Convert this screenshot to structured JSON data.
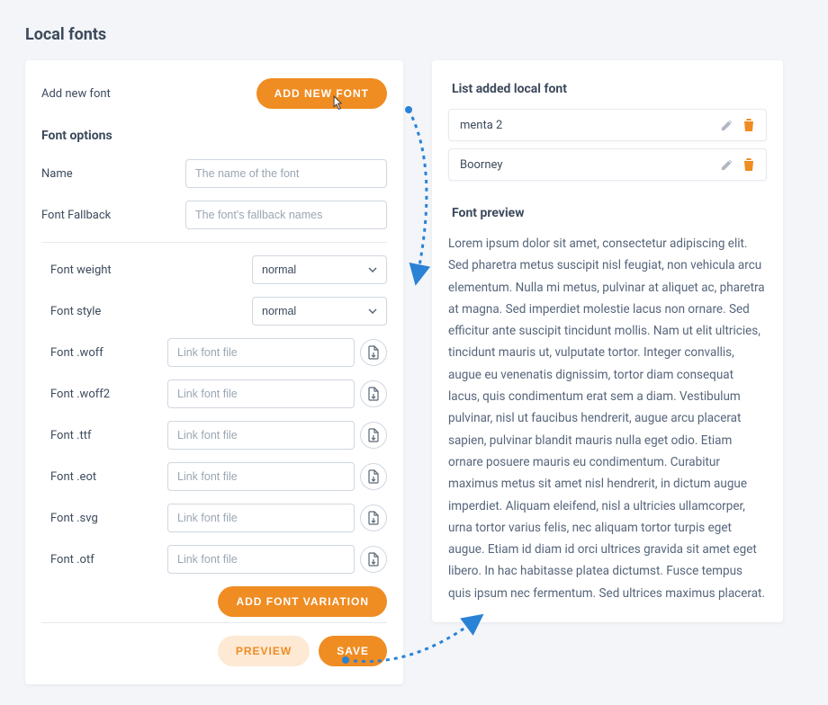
{
  "page_title": "Local fonts",
  "left": {
    "add_new_font_label": "Add new font",
    "add_new_font_btn": "ADD NEW FONT",
    "font_options_title": "Font options",
    "name_label": "Name",
    "name_placeholder": "The name of the font",
    "fallback_label": "Font Fallback",
    "fallback_placeholder": "The font's fallback names",
    "weight_label": "Font weight",
    "weight_value": "normal",
    "style_label": "Font style",
    "style_value": "normal",
    "file_rows": [
      {
        "label": "Font .woff",
        "placeholder": "Link font file"
      },
      {
        "label": "Font .woff2",
        "placeholder": "Link font file"
      },
      {
        "label": "Font .ttf",
        "placeholder": "Link font file"
      },
      {
        "label": "Font .eot",
        "placeholder": "Link font file"
      },
      {
        "label": "Font .svg",
        "placeholder": "Link font file"
      },
      {
        "label": "Font .otf",
        "placeholder": "Link font file"
      }
    ],
    "add_variation_btn": "ADD FONT VARIATION",
    "preview_btn": "PREVIEW",
    "save_btn": "SAVE"
  },
  "right": {
    "list_title": "List added local font",
    "fonts": [
      {
        "name": "menta 2"
      },
      {
        "name": "Boorney"
      }
    ],
    "preview_title": "Font preview",
    "preview_text": "Lorem ipsum dolor sit amet, consectetur adipiscing elit. Sed pharetra metus suscipit nisl feugiat, non vehicula arcu elementum. Nulla mi metus, pulvinar at aliquet ac, pharetra at magna. Sed imperdiet molestie lacus non ornare. Sed efficitur ante suscipit tincidunt mollis. Nam ut elit ultricies, tincidunt mauris ut, vulputate tortor. Integer convallis, augue eu venenatis dignissim, tortor diam consequat lacus, quis condimentum erat sem a diam. Vestibulum pulvinar, nisl ut faucibus hendrerit, augue arcu placerat sapien, pulvinar blandit mauris nulla eget odio. Etiam ornare posuere mauris eu condimentum. Curabitur maximus metus sit amet nisl hendrerit, in dictum augue imperdiet. Aliquam eleifend, nisl a ultricies ullamcorper, urna tortor varius felis, nec aliquam tortor turpis eget augue. Etiam id diam id orci ultrices gravida sit amet eget libero. In hac habitasse platea dictumst. Fusce tempus quis ipsum nec fermentum. Sed ultrices maximus placerat."
  },
  "colors": {
    "accent": "#ef8c22",
    "accentLight": "#fde9d4",
    "arrow": "#2a82d6"
  }
}
